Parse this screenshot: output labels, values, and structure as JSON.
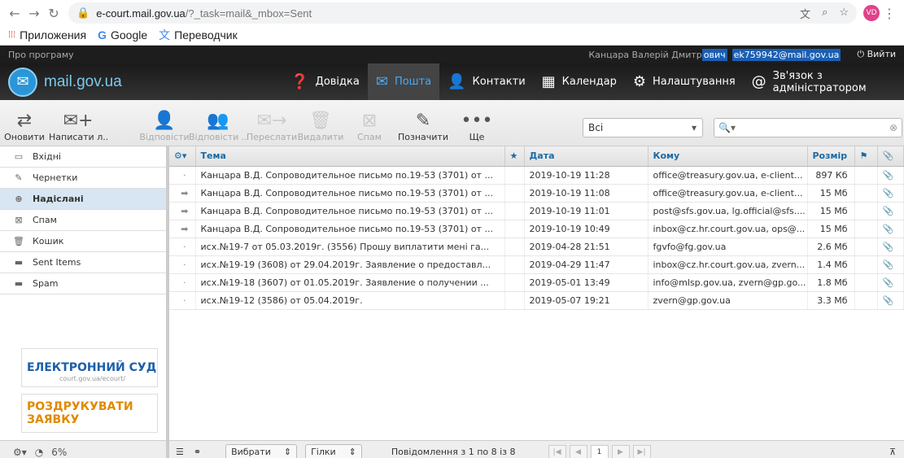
{
  "browser": {
    "url_host": "e-court.mail.gov.ua",
    "url_path": "/?_task=mail&_mbox=Sent",
    "avatar": "VD",
    "bookmarks": [
      "Приложения",
      "Google",
      "Переводчик"
    ]
  },
  "topbar": {
    "about": "Про програму",
    "user_name_a": "Канцара Валерій Дмитр",
    "user_name_b": "ович",
    "email": "ek759942@mail.gov.ua",
    "logout": "Вийти"
  },
  "header": {
    "logo": "mail.gov.ua",
    "nav": [
      {
        "label": "Довідка",
        "icon": "help-icon"
      },
      {
        "label": "Пошта",
        "icon": "mail-icon"
      },
      {
        "label": "Контакти",
        "icon": "contacts-icon"
      },
      {
        "label": "Календар",
        "icon": "calendar-icon"
      },
      {
        "label": "Налаштування",
        "icon": "gear-icon"
      },
      {
        "label": "Зв'язок з адміністратором",
        "icon": "at-icon"
      }
    ]
  },
  "toolbar": {
    "refresh": "Оновити",
    "compose": "Написати л...",
    "reply": "Відповісти",
    "reply_all": "Відповісти ...",
    "forward": "Переслати",
    "delete": "Видалити",
    "spam": "Спам",
    "mark": "Позначити",
    "more": "Ще",
    "filter_value": "Всі"
  },
  "folders": [
    {
      "label": "Вхідні",
      "icon": "inbox-icon"
    },
    {
      "label": "Чернетки",
      "icon": "pencil-icon"
    },
    {
      "label": "Надіслані",
      "icon": "sent-icon"
    },
    {
      "label": "Спам",
      "icon": "spam-icon"
    },
    {
      "label": "Кошик",
      "icon": "trash-icon"
    },
    {
      "label": "Sent Items",
      "icon": "folder-icon"
    },
    {
      "label": "Spam",
      "icon": "folder-icon"
    }
  ],
  "banners": {
    "court_title": "ЕЛЕКТРОННИЙ СУД",
    "court_sub": "court.gov.ua/ecourt/",
    "print_title": "РОЗДРУКУВАТИ ЗАЯВКУ"
  },
  "columns": {
    "subject": "Тема",
    "date": "Дата",
    "to": "Кому",
    "size": "Розмір"
  },
  "messages": [
    {
      "subject": "Канцара В.Д. Сопроводительное письмо по.19-53 (3701) от ...",
      "date": "2019-10-19 11:28",
      "to": "office@treasury.gov.ua, e-client...",
      "size": "897 Кб",
      "forwarded": false
    },
    {
      "subject": "Канцара В.Д. Сопроводительное письмо по.19-53 (3701) от ...",
      "date": "2019-10-19 11:08",
      "to": "office@treasury.gov.ua, e-client...",
      "size": "15 Мб",
      "forwarded": true
    },
    {
      "subject": "Канцара В.Д. Сопроводительное письмо по.19-53 (3701) от ...",
      "date": "2019-10-19 11:01",
      "to": "post@sfs.gov.ua, lg.official@sfs....",
      "size": "15 Мб",
      "forwarded": true
    },
    {
      "subject": "Канцара В.Д. Сопроводительное письмо по.19-53 (3701) от ...",
      "date": "2019-10-19 10:49",
      "to": "inbox@cz.hr.court.gov.ua, ops@...",
      "size": "15 Мб",
      "forwarded": true
    },
    {
      "subject": "исх.№19-7 от 05.03.2019г. (3556) Прошу виплатити мені га...",
      "date": "2019-04-28 21:51",
      "to": "fgvfo@fg.gov.ua",
      "size": "2.6 Мб",
      "forwarded": false
    },
    {
      "subject": "исх.№19-19 (3608) от 29.04.2019г. Заявление о предоставл...",
      "date": "2019-04-29 11:47",
      "to": "inbox@cz.hr.court.gov.ua, zvern...",
      "size": "1.4 Мб",
      "forwarded": false
    },
    {
      "subject": "исх.№19-18 (3607) от 01.05.2019г. Заявление о получении ...",
      "date": "2019-05-01 13:49",
      "to": "info@mlsp.gov.ua, zvern@gp.go...",
      "size": "1.8 Мб",
      "forwarded": false
    },
    {
      "subject": "исх.№19-12 (3586) от 05.04.2019г.",
      "date": "2019-05-07 19:21",
      "to": "zvern@gp.gov.ua",
      "size": "3.3 Мб",
      "forwarded": false
    }
  ],
  "footer": {
    "quota": "6%",
    "select": "Вибрати",
    "threads": "Гілки",
    "count": "Повідомлення з 1 по 8 із 8",
    "page": "1"
  }
}
